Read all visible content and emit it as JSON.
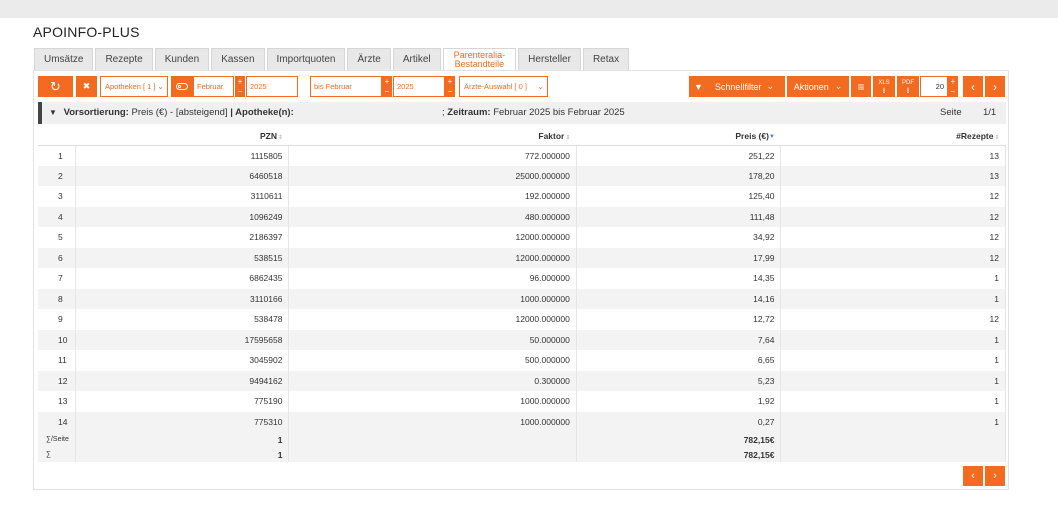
{
  "app": {
    "title": "APOINFO-PLUS"
  },
  "tabs": [
    {
      "label": "Umsätze"
    },
    {
      "label": "Rezepte"
    },
    {
      "label": "Kunden"
    },
    {
      "label": "Kassen"
    },
    {
      "label": "Importquoten"
    },
    {
      "label": "Ärzte"
    },
    {
      "label": "Artikel"
    },
    {
      "label_line1": "Parenteralia-",
      "label_line2": "Bestandteile"
    },
    {
      "label": "Hersteller"
    },
    {
      "label": "Retax"
    }
  ],
  "toolbar": {
    "refresh_icon": "↻",
    "clear_icon": "✖",
    "apotheken": "Apotheken [ 1 ]",
    "month_from": "Februar",
    "year_from": "2025",
    "month_to": "bis Februar",
    "year_to": "2025",
    "aerzte": "Ärzte-Auswahl [ 0 ]",
    "schnellfilter": "Schnellfilter",
    "aktionen": "Aktionen",
    "menu_icon": "≡",
    "xls": "XLS",
    "pdf": "PDF",
    "page_size": "20",
    "prev": "‹",
    "next": "›"
  },
  "info": {
    "sort_label": "Vorsortierung:",
    "sort_value": "Preis (€) - [absteigend]",
    "apotheke_label": "| Apotheke(n):",
    "zeitraum_prefix": ";",
    "zeitraum_label": "Zeitraum:",
    "zeitraum_value": "Februar 2025 bis Februar 2025",
    "seite_label": "Seite",
    "seite_value": "1/1"
  },
  "table": {
    "headers": {
      "pzn": "PZN",
      "faktor": "Faktor",
      "preis": "Preis (€)",
      "rezepte": "#Rezepte"
    },
    "rows": [
      {
        "n": "1",
        "pzn": "1115805",
        "faktor": "772.000000",
        "preis": "251,22",
        "rezepte": "13"
      },
      {
        "n": "2",
        "pzn": "6460518",
        "faktor": "25000.000000",
        "preis": "178,20",
        "rezepte": "13"
      },
      {
        "n": "3",
        "pzn": "3110611",
        "faktor": "192.000000",
        "preis": "125,40",
        "rezepte": "12"
      },
      {
        "n": "4",
        "pzn": "1096249",
        "faktor": "480.000000",
        "preis": "111,48",
        "rezepte": "12"
      },
      {
        "n": "5",
        "pzn": "2186397",
        "faktor": "12000.000000",
        "preis": "34,92",
        "rezepte": "12"
      },
      {
        "n": "6",
        "pzn": "538515",
        "faktor": "12000.000000",
        "preis": "17,99",
        "rezepte": "12"
      },
      {
        "n": "7",
        "pzn": "6862435",
        "faktor": "96.000000",
        "preis": "14,35",
        "rezepte": "1"
      },
      {
        "n": "8",
        "pzn": "3110166",
        "faktor": "1000.000000",
        "preis": "14,16",
        "rezepte": "1"
      },
      {
        "n": "9",
        "pzn": "538478",
        "faktor": "12000.000000",
        "preis": "12,72",
        "rezepte": "12"
      },
      {
        "n": "10",
        "pzn": "17595658",
        "faktor": "50.000000",
        "preis": "7,64",
        "rezepte": "1"
      },
      {
        "n": "11",
        "pzn": "3045902",
        "faktor": "500.000000",
        "preis": "6,65",
        "rezepte": "1"
      },
      {
        "n": "12",
        "pzn": "9494162",
        "faktor": "0.300000",
        "preis": "5,23",
        "rezepte": "1"
      },
      {
        "n": "13",
        "pzn": "775190",
        "faktor": "1000.000000",
        "preis": "1,92",
        "rezepte": "1"
      },
      {
        "n": "14",
        "pzn": "775310",
        "faktor": "1000.000000",
        "preis": "0,27",
        "rezepte": "1"
      }
    ],
    "sum_page": {
      "label": "∑/Seite",
      "pzn": "1",
      "preis": "782,15€"
    },
    "sum_total": {
      "label": "∑",
      "pzn": "1",
      "preis": "782,15€"
    }
  },
  "pager": {
    "prev": "‹",
    "next": "›"
  }
}
